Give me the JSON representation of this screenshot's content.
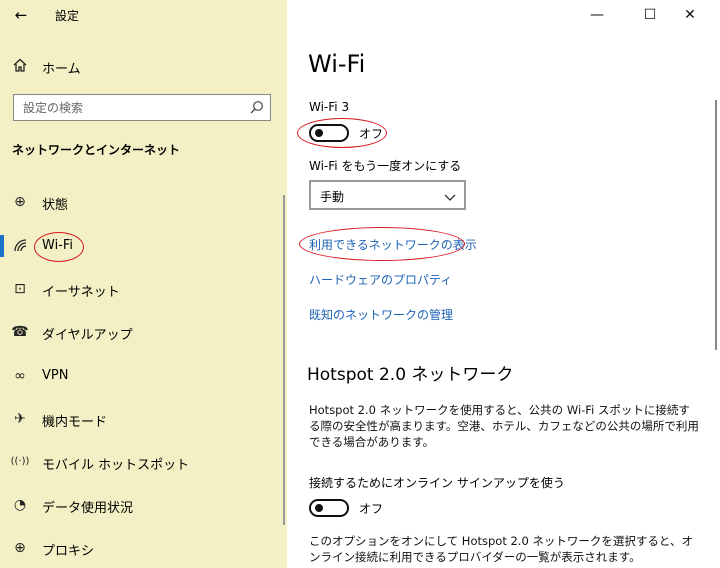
{
  "window": {
    "title": "設定",
    "back_glyph": "←",
    "min_glyph": "—",
    "max_glyph": "☐",
    "close_glyph": "✕"
  },
  "sidebar": {
    "home_label": "ホーム",
    "search_placeholder": "設定の検索",
    "section_title": "ネットワークとインターネット",
    "items": [
      {
        "label": "状態",
        "icon": "globe-icon",
        "glyph": "⊕"
      },
      {
        "label": "Wi-Fi",
        "icon": "wifi-icon",
        "glyph": "◜"
      },
      {
        "label": "イーサネット",
        "icon": "ethernet-icon",
        "glyph": "⊡"
      },
      {
        "label": "ダイヤルアップ",
        "icon": "dialup-icon",
        "glyph": "☎"
      },
      {
        "label": "VPN",
        "icon": "vpn-icon",
        "glyph": "∞"
      },
      {
        "label": "機内モード",
        "icon": "airplane-icon",
        "glyph": "✈"
      },
      {
        "label": "モバイル ホットスポット",
        "icon": "hotspot-icon",
        "glyph": "((·))"
      },
      {
        "label": "データ使用状況",
        "icon": "data-usage-icon",
        "glyph": "◔"
      },
      {
        "label": "プロキシ",
        "icon": "proxy-icon",
        "glyph": "⊕"
      }
    ]
  },
  "main": {
    "title": "Wi-Fi",
    "adapter_name": "Wi-Fi 3",
    "wifi_toggle_state": "オフ",
    "turn_back_on_label": "Wi-Fi をもう一度オンにする",
    "turn_back_on_value": "手動",
    "links": {
      "show_networks": "利用できるネットワークの表示",
      "hardware_properties": "ハードウェアのプロパティ",
      "manage_known": "既知のネットワークの管理"
    },
    "hotspot": {
      "heading": "Hotspot 2.0 ネットワーク",
      "description": "Hotspot 2.0 ネットワークを使用すると、公共の Wi-Fi スポットに接続する際の安全性が高まります。空港、ホテル、カフェなどの公共の場所で利用できる場合があります。",
      "signup_label": "接続するためにオンライン サインアップを使う",
      "signup_toggle_state": "オフ",
      "footer_text": "このオプションをオンにして Hotspot 2.0 ネットワークを選択すると、オンライン接続に利用できるプロバイダーの一覧が表示されます。"
    }
  },
  "colors": {
    "sidebar_bg": "#f2f0c4",
    "link": "#1d62b5",
    "accent": "#1a73c8",
    "annotation": "#d9191e"
  }
}
